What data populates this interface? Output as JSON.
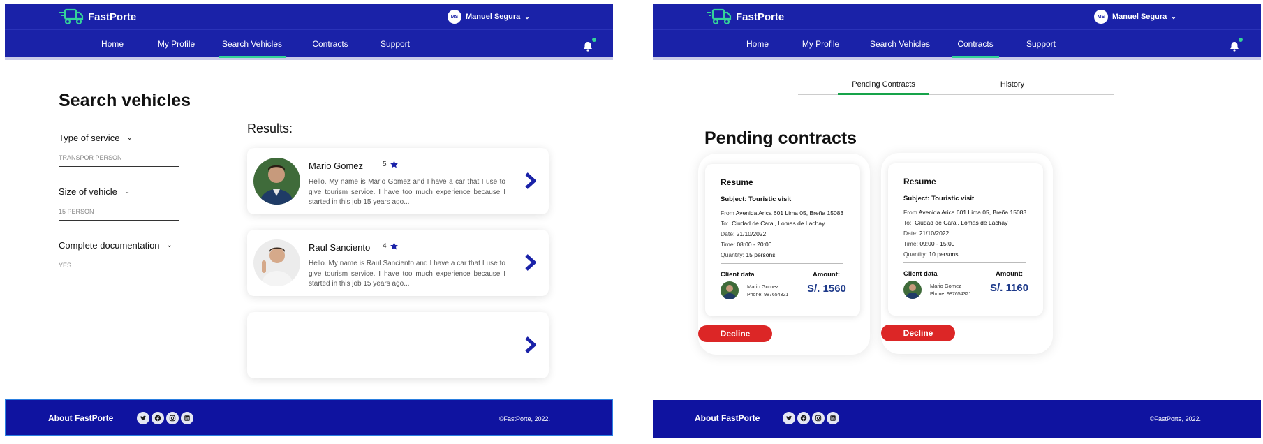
{
  "app": {
    "brand": "FastPorte",
    "user_initials": "MS",
    "user_name": "Manuel Segura",
    "nav": [
      "Home",
      "My Profile",
      "Search Vehicles",
      "Contracts",
      "Support"
    ],
    "accent_color": "#34d399",
    "primary_color": "#1a22a8"
  },
  "search_page": {
    "title": "Search vehicles",
    "filters": [
      {
        "label": "Type of service",
        "value": "TRANSPOR PERSON"
      },
      {
        "label": "Size of vehicle",
        "value": "15 PERSON"
      },
      {
        "label": "Complete documentation",
        "value": "YES"
      }
    ],
    "results_label": "Results:",
    "results": [
      {
        "name": "Mario Gomez",
        "rating": "5",
        "description": "Hello. My name is Mario Gomez and I have a car that I use to give tourism service. I have too much experience because I started in this job 15 years ago..."
      },
      {
        "name": "Raul Sanciento",
        "rating": "4",
        "description": "Hello. My name is Raul Sanciento and I have a car that I use to give tourism service. I have too much experience because I started in this job 15 years ago..."
      }
    ]
  },
  "contracts_page": {
    "tabs": [
      "Pending Contracts",
      "History"
    ],
    "title": "Pending contracts",
    "labels": {
      "resume": "Resume",
      "from": "From",
      "to": "To:",
      "date": "Date:",
      "time": "Time:",
      "quantity": "Quantity:",
      "client_data": "Client data",
      "amount": "Amount:",
      "phone": "Phone:",
      "decline": "Decline"
    },
    "contracts": [
      {
        "subject": "Subject: Touristic visit",
        "from": "Avenida Arica 601 Lima 05, Breña 15083",
        "to": "Ciudad de Caral, Lomas de Lachay",
        "date": "21/10/2022",
        "time": "08:00 - 20:00",
        "quantity": "15 persons",
        "client_name": "Mario Gomez",
        "phone": "987654321",
        "amount": "S/. 1560"
      },
      {
        "subject": "Subject: Touristic visit",
        "from": "Avenida Arica 601 Lima 05, Breña 15083",
        "to": "Ciudad de Caral, Lomas de Lachay",
        "date": "21/10/2022",
        "time": "09:00 - 15:00",
        "quantity": "10 persons",
        "client_name": "Mario Gomez",
        "phone": "987654321",
        "amount": "S/. 1160"
      }
    ]
  },
  "footer": {
    "about": "About FastPorte",
    "socials": [
      "twitter-icon",
      "facebook-icon",
      "instagram-icon",
      "linkedin-icon"
    ],
    "copyright": "©FastPorte, 2022."
  }
}
